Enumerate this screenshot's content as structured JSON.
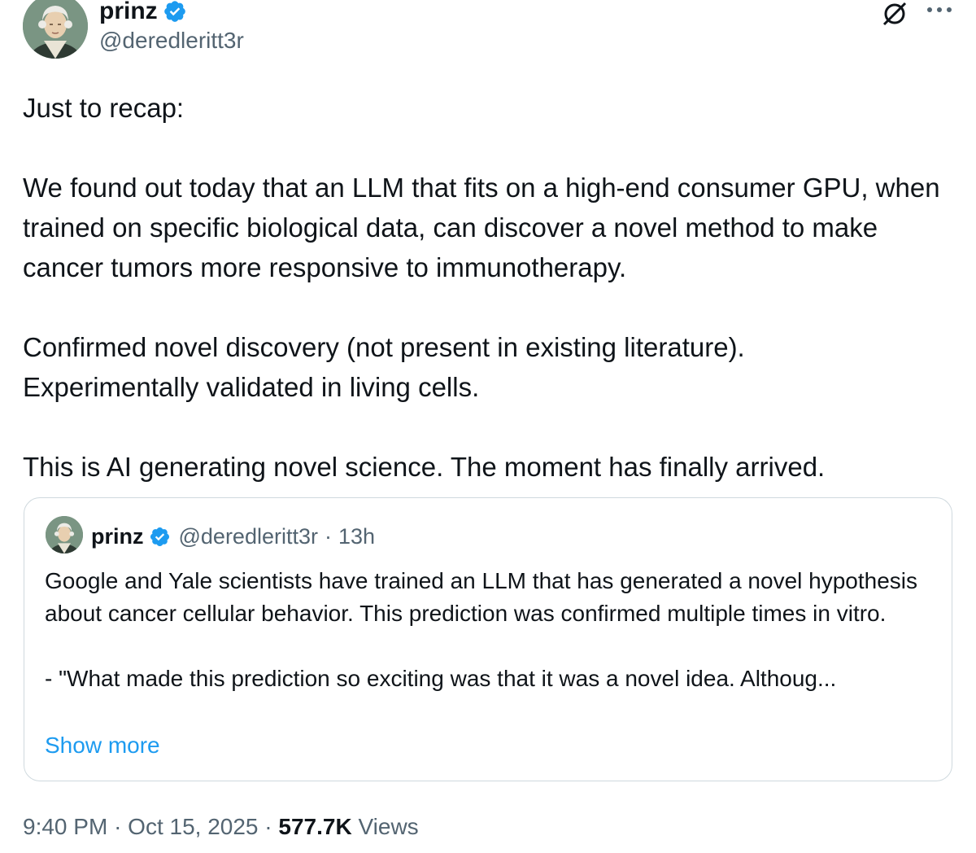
{
  "author": {
    "display_name": "prinz",
    "handle": "@deredleritt3r",
    "verified_color": "#1d9bf0"
  },
  "header_icons": [
    "grok-icon",
    "more-icon"
  ],
  "tweet": {
    "paragraphs": [
      "Just to recap:",
      "We found out today that an LLM that fits on a high-end consumer GPU, when trained on specific biological data, can discover a novel method to make cancer tumors more responsive to immunotherapy.",
      "Confirmed novel discovery (not present in existing literature).",
      "Experimentally validated in living cells.",
      "This is AI generating novel science. The moment has finally arrived."
    ]
  },
  "quote": {
    "display_name": "prinz",
    "handle": "@deredleritt3r",
    "separator": "·",
    "time": "13h",
    "text": "Google and Yale scientists have trained an LLM that has generated a novel hypothesis about cancer cellular behavior. This prediction was confirmed multiple times in vitro.",
    "excerpt": "- \"What made this prediction so exciting was that it was a novel idea. Althoug...",
    "show_more": "Show more"
  },
  "footer": {
    "time": "9:40 PM",
    "separator": "·",
    "date": "Oct 15, 2025",
    "views_count": "577.7K",
    "views_label": "Views"
  },
  "colors": {
    "text": "#0f1419",
    "secondary": "#536471",
    "link": "#1d9bf0",
    "border": "#cfd9de"
  }
}
